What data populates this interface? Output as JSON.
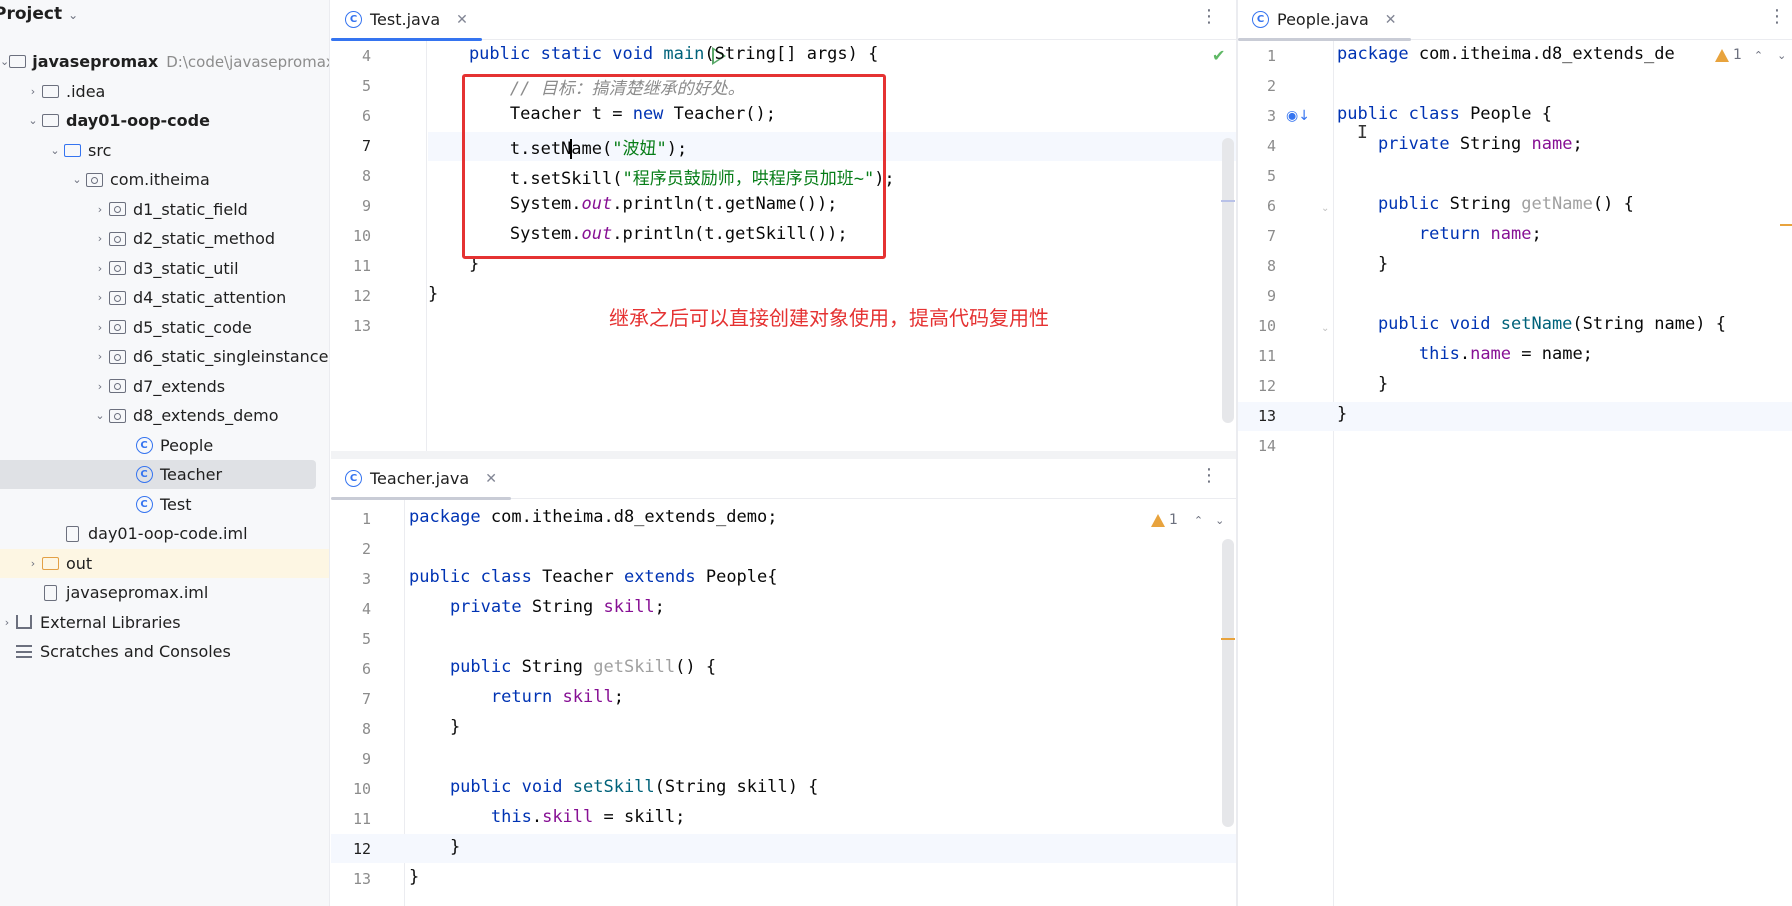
{
  "project": {
    "title": "Project",
    "root_name": "javasepromax",
    "root_path": "D:\\code\\javasepromax",
    "items": [
      {
        "label": "javasepromax",
        "icon": "folder-icon",
        "depth": 0,
        "arrow": "open"
      },
      {
        "label": ".idea",
        "icon": "folder-icon",
        "depth": 1,
        "arrow": "closed"
      },
      {
        "label": "day01-oop-code",
        "icon": "module-folder-icon",
        "depth": 1,
        "arrow": "open"
      },
      {
        "label": "src",
        "icon": "source-folder-icon",
        "depth": 2,
        "arrow": "open"
      },
      {
        "label": "com.itheima",
        "icon": "package-icon",
        "depth": 3,
        "arrow": "open"
      },
      {
        "label": "d1_static_field",
        "icon": "package-icon",
        "depth": 4,
        "arrow": "closed"
      },
      {
        "label": "d2_static_method",
        "icon": "package-icon",
        "depth": 4,
        "arrow": "closed"
      },
      {
        "label": "d3_static_util",
        "icon": "package-icon",
        "depth": 4,
        "arrow": "closed"
      },
      {
        "label": "d4_static_attention",
        "icon": "package-icon",
        "depth": 4,
        "arrow": "closed"
      },
      {
        "label": "d5_static_code",
        "icon": "package-icon",
        "depth": 4,
        "arrow": "closed"
      },
      {
        "label": "d6_static_singleinstance",
        "icon": "package-icon",
        "depth": 4,
        "arrow": "closed"
      },
      {
        "label": "d7_extends",
        "icon": "package-icon",
        "depth": 4,
        "arrow": "closed"
      },
      {
        "label": "d8_extends_demo",
        "icon": "package-icon",
        "depth": 4,
        "arrow": "open"
      },
      {
        "label": "People",
        "icon": "class-icon",
        "depth": 5,
        "arrow": "none"
      },
      {
        "label": "Teacher",
        "icon": "class-icon",
        "depth": 5,
        "arrow": "none",
        "selected": true
      },
      {
        "label": "Test",
        "icon": "class-icon",
        "depth": 5,
        "arrow": "none"
      },
      {
        "label": "day01-oop-code.iml",
        "icon": "file-icon",
        "depth": 2,
        "arrow": "none"
      },
      {
        "label": "out",
        "icon": "excluded-folder-icon",
        "depth": 1,
        "arrow": "closed",
        "highlight": true
      },
      {
        "label": "javasepromax.iml",
        "icon": "file-icon",
        "depth": 1,
        "arrow": "none"
      },
      {
        "label": "External Libraries",
        "icon": "library-icon",
        "depth": 0,
        "arrow": "closed"
      },
      {
        "label": "Scratches and Consoles",
        "icon": "scratches-icon",
        "depth": 0,
        "arrow": "none"
      }
    ]
  },
  "editors": {
    "test": {
      "tab": "Test.java",
      "lines": [
        "4",
        "5",
        "6",
        "7",
        "8",
        "9",
        "10",
        "11",
        "12",
        "13"
      ],
      "current_line": "7",
      "code": {
        "l4_a": "    public static void ",
        "l4_fn": "main",
        "l4_b": "(String[] args) {",
        "l5": "        // 目标：搞清楚继承的好处。",
        "l6_a": "        Teacher t = ",
        "l6_kw": "new",
        "l6_b": " Teacher();",
        "l7_a": "        t.setN",
        "l7_b": "ame(",
        "l7_str": "\"波妞\"",
        "l7_c": ");",
        "l8_a": "        t.setSkill(",
        "l8_str": "\"程序员鼓励师，哄程序员加班~\"",
        "l8_b": ");",
        "l9_a": "        System.",
        "l9_st": "out",
        "l9_b": ".println(t.getName());",
        "l10_a": "        System.",
        "l10_st": "out",
        "l10_b": ".println(t.getSkill());",
        "l11": "    }",
        "l12": "}"
      },
      "annotation": "继承之后可以直接创建对象使用，提高代码复用性"
    },
    "teacher": {
      "tab": "Teacher.java",
      "lines": [
        "1",
        "2",
        "3",
        "4",
        "5",
        "6",
        "7",
        "8",
        "9",
        "10",
        "11",
        "12",
        "13"
      ],
      "current_line": "12",
      "warning_count": "1",
      "code": {
        "l1_kw": "package",
        "l1_b": " com.itheima.d8_extends_demo;",
        "l3_kw": "public class",
        "l3_b": " Teacher ",
        "l3_kw2": "extends",
        "l3_c": " People{",
        "l4_kw": "    private",
        "l4_b": " String ",
        "l4_fld": "skill",
        "l4_c": ";",
        "l6_kw": "    public",
        "l6_b": " String ",
        "l6_fn": "getSkill",
        "l6_c": "() {",
        "l7_kw": "        return",
        "l7_fld": " skill",
        "l7_c": ";",
        "l8": "    }",
        "l10_kw": "    public void",
        "l10_fn": " setSkill",
        "l10_b": "(String skill) {",
        "l11_kw": "        this",
        "l11_b": ".",
        "l11_fld": "skill",
        "l11_c": " = skill;",
        "l12": "    }",
        "l13": "}"
      }
    },
    "people": {
      "tab": "People.java",
      "lines": [
        "1",
        "2",
        "3",
        "4",
        "5",
        "6",
        "7",
        "8",
        "9",
        "10",
        "11",
        "12",
        "13",
        "14"
      ],
      "current_line": "13",
      "warning_count": "1",
      "code": {
        "l1_kw": "package",
        "l1_b": " com.itheima.d8_extends_de",
        "l3_kw": "public class",
        "l3_b": " People {",
        "l4_kw": "    private",
        "l4_b": " String ",
        "l4_fld": "name",
        "l4_c": ";",
        "l6_kw": "    public",
        "l6_b": " String ",
        "l6_fn": "getName",
        "l6_c": "() {",
        "l7_kw": "        return",
        "l7_fld": " name",
        "l7_c": ";",
        "l8": "    }",
        "l10_kw": "    public void",
        "l10_fn": " setName",
        "l10_b": "(String name) {",
        "l11_kw": "        this",
        "l11_b": ".",
        "l11_fld": "name",
        "l11_c": " = name;",
        "l12": "    }",
        "l13": "}"
      }
    }
  },
  "colors": {
    "keyword": "#0033b3",
    "string": "#067d17",
    "field": "#871094",
    "method": "#00627a",
    "annotation_red": "#e53232",
    "accent": "#3574f0"
  }
}
